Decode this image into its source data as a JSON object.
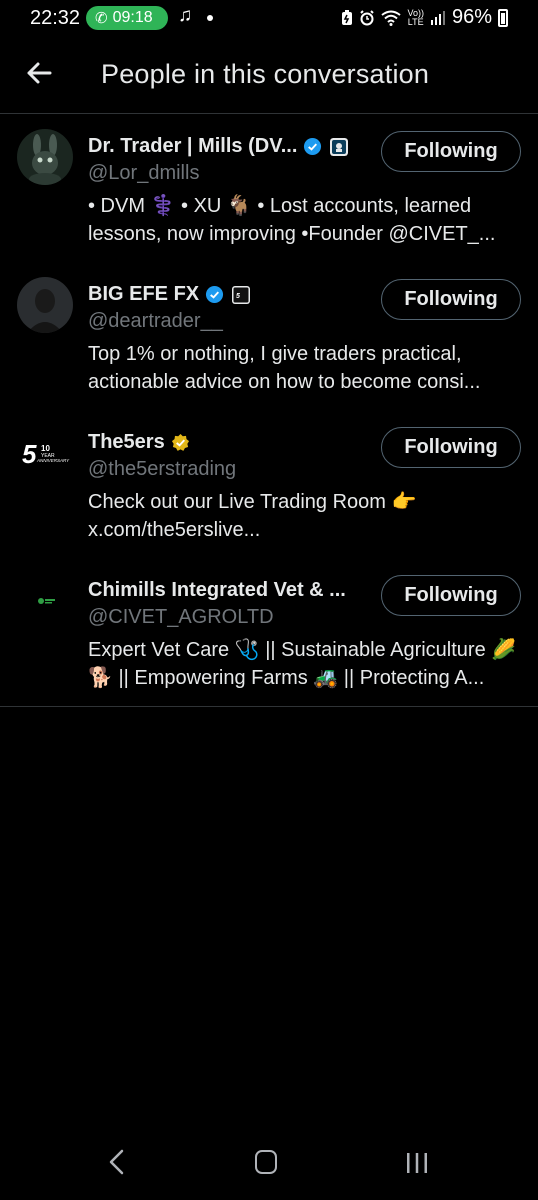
{
  "status_bar": {
    "time": "22:32",
    "call_timer": "09:18",
    "battery": "96%",
    "lte_top": "Vo))",
    "lte_bottom": "LTE"
  },
  "header": {
    "title": "People in this conversation"
  },
  "people": [
    {
      "name": "Dr. Trader | Mills (DV...",
      "handle": "@Lor_dmills",
      "bio": "• DVM ⚕️ • XU 🐐 • Lost accounts, learned lessons, now improving •Founder @CIVET_...",
      "button": "Following",
      "verified_color": "#1d9bf0"
    },
    {
      "name": "BIG EFE FX",
      "handle": "@deartrader__",
      "bio": "Top 1% or nothing, I give traders practical, actionable advice on how to become consi...",
      "button": "Following",
      "verified_color": "#1d9bf0"
    },
    {
      "name": "The5ers",
      "handle": "@the5erstrading",
      "bio": "Check out our Live Trading Room 👉 x.com/the5erslive...",
      "button": "Following",
      "verified_color": "#e2b719"
    },
    {
      "name": "Chimills Integrated Vet & ...",
      "handle": "@CIVET_AGROLTD",
      "bio": "Expert Vet Care 🩺 || Sustainable Agriculture 🌽🐕 || Empowering Farms 🚜 || Protecting A...",
      "button": "Following"
    }
  ],
  "avatars": {
    "the5ers_logo": "5",
    "the5ers_sub": "YEAR",
    "the5ers_sub2": "ANNIVERSARY",
    "the5ers_num": "10"
  },
  "colors": {
    "background": "#000000",
    "text": "#e7e9ea",
    "muted": "#71767b",
    "divider": "#2f3336",
    "call_green": "#2fb457"
  }
}
